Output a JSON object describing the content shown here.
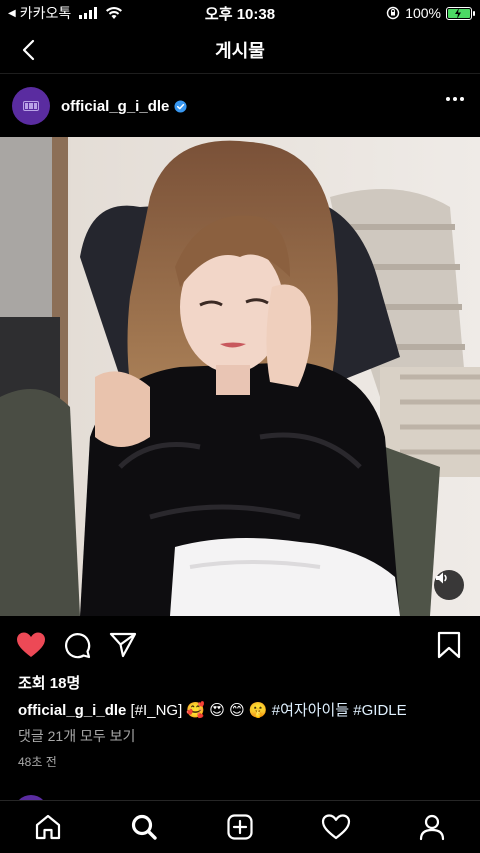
{
  "status_bar": {
    "carrier": "카카오톡",
    "time": "오후 10:38",
    "battery": "100%"
  },
  "nav": {
    "title": "게시물"
  },
  "post": {
    "username": "official_g_i_dle",
    "verified": true,
    "views": "조회 18명",
    "caption": {
      "username": "official_g_i_dle",
      "text_prefix": "[#I_NG]",
      "emojis": [
        "🥰",
        "😍",
        "😊",
        "🤫"
      ],
      "hashtags": [
        "#여자아이들",
        "#GIDLE"
      ]
    },
    "comments_link": "댓글 21개 모두 보기",
    "timestamp": "48초 전"
  },
  "icons": {
    "like": "heart-icon",
    "comment": "comment-icon",
    "share": "share-icon",
    "save": "bookmark-icon",
    "volume": "volume-icon"
  },
  "tabbar": [
    "home-icon",
    "search-icon",
    "add-icon",
    "activity-icon",
    "profile-icon"
  ],
  "colors": {
    "like_red": "#ed4956",
    "verified_blue": "#3897f0",
    "battery_green": "#4cd964",
    "brand_purple": "#5a2ca0"
  }
}
